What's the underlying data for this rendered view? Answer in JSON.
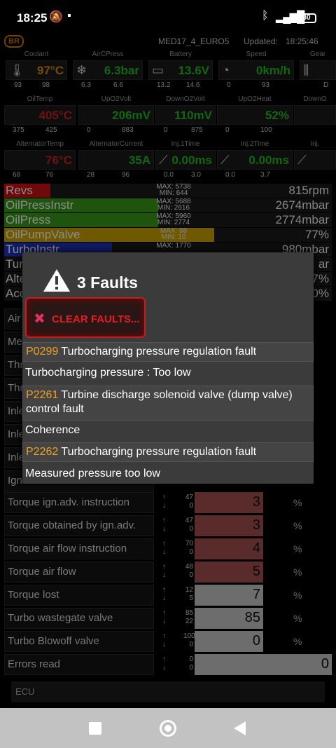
{
  "status": {
    "time": "18:25",
    "battery": "30"
  },
  "header": {
    "badge": "BR",
    "ecu": "MED17_4_EURO5",
    "updated_label": "Updated:",
    "updated_time": "18:25:46"
  },
  "gauges_row1": [
    {
      "label": "Coolant",
      "icon": "thermometer-icon",
      "glyph": "🌡",
      "value": "97°C",
      "color": "#d88a00",
      "min": "93",
      "max": "98"
    },
    {
      "label": "AirCPress",
      "icon": "snowflake-icon",
      "glyph": "❄",
      "value": "6.3bar",
      "color": "#22bb22",
      "min": "6.3",
      "max": "6.6"
    },
    {
      "label": "Battery",
      "icon": "battery-icon",
      "glyph": "▭",
      "value": "13.6V",
      "color": "#22bb22",
      "min": "13.2",
      "max": "14.6"
    },
    {
      "label": "Speed",
      "icon": "speedometer-icon",
      "glyph": "◔",
      "value": "0km/h",
      "color": "#22bb22",
      "min": "0",
      "max": "93"
    },
    {
      "label": "Gear",
      "icon": "gear-shift-icon",
      "glyph": "⫼",
      "value": "",
      "color": "#22bb22",
      "min": "",
      "max": "D"
    }
  ],
  "gauges_row2": [
    {
      "label": "OilTemp",
      "value": "405°C",
      "color": "#cc2222",
      "min": "375",
      "max": "425"
    },
    {
      "label": "UpO2Volt",
      "value": "206mV",
      "color": "#22bb22",
      "min": "0",
      "max": "883"
    },
    {
      "label": "DownO2Volt",
      "value": "110mV",
      "color": "#22bb22",
      "min": "0",
      "max": "875"
    },
    {
      "label": "UpO2Heat",
      "value": "52%",
      "color": "#22bb22",
      "min": "0",
      "max": "100"
    },
    {
      "label": "DownO",
      "value": "",
      "color": "#22bb22",
      "min": "",
      "max": ""
    }
  ],
  "gauges_row3": [
    {
      "label": "AlternatorTemp",
      "value": "76°C",
      "color": "#cc2222",
      "min": "68",
      "max": "76"
    },
    {
      "label": "AlternatorCurrent",
      "value": "35A",
      "color": "#22bb22",
      "min": "28",
      "max": "96"
    },
    {
      "label": "Inj.1Time",
      "icon": "injector-icon",
      "glyph": "⟋",
      "value": "0.00ms",
      "color": "#22bb22",
      "min": "0.0",
      "max": "3.0"
    },
    {
      "label": "Inj.2Time",
      "icon": "injector-icon",
      "glyph": "⟋",
      "value": "0.00ms",
      "color": "#22bb22",
      "min": "0.0",
      "max": "3.7"
    },
    {
      "label": "Inj.",
      "icon": "injector-icon",
      "glyph": "⟋",
      "value": "",
      "color": "#22bb22",
      "min": "",
      "max": ""
    }
  ],
  "bars": [
    {
      "name": "Revs",
      "max": "MAX: 5738",
      "min": "MIN: 644",
      "value": "815rpm",
      "fill": 0.14,
      "color": "#cc1111"
    },
    {
      "name": "OilPressInstr",
      "max": "MAX: 5688",
      "min": "MIN: 2616",
      "value": "2674mbar",
      "fill": 0.47,
      "color": "#3a9a1a"
    },
    {
      "name": "OilPress",
      "max": "MAX: 5960",
      "min": "MIN: 2774",
      "value": "2774mbar",
      "fill": 0.47,
      "color": "#3a9a1a"
    },
    {
      "name": "OilPumpValve",
      "max": "MAX: 88",
      "min": "MIN: 10",
      "value": "77%",
      "fill": 0.64,
      "color": "#c8a000"
    },
    {
      "name": "TurboInstr",
      "max": "MAX: 1770",
      "min": "",
      "value": "980mbar",
      "fill": 0.33,
      "color": "#2233bb"
    },
    {
      "name": "Tur",
      "max": "",
      "min": "",
      "value": "ar",
      "fill": 0.0,
      "color": "#3a9a1a"
    },
    {
      "name": "Alte",
      "max": "",
      "min": "",
      "value": "7%",
      "fill": 0.0,
      "color": "#3a9a1a"
    },
    {
      "name": "Acc",
      "max": "",
      "min": "",
      "value": "0%",
      "fill": 0.0,
      "color": "#3a9a1a"
    }
  ],
  "hidden_rows": [
    "Air",
    "Me",
    "Thr",
    "Thr",
    "Inle",
    "Inle",
    "Inle",
    "Ign"
  ],
  "table": [
    {
      "name": "Torque ign.adv. instruction",
      "max": "47",
      "min": "0",
      "value": "3",
      "unit": "%",
      "red": true
    },
    {
      "name": "Torque obtained by ign.adv.",
      "max": "47",
      "min": "0",
      "value": "3",
      "unit": "%",
      "red": true
    },
    {
      "name": "Torque air flow instruction",
      "max": "70",
      "min": "0",
      "value": "4",
      "unit": "%",
      "red": true
    },
    {
      "name": "Torque air flow",
      "max": "48",
      "min": "0",
      "value": "5",
      "unit": "%",
      "red": true
    },
    {
      "name": "Torque lost",
      "max": "12",
      "min": "5",
      "value": "7",
      "unit": "%",
      "red": false
    },
    {
      "name": "Turbo wastegate valve",
      "max": "85",
      "min": "22",
      "value": "85",
      "unit": "%",
      "red": false
    },
    {
      "name": "Turbo Blowoff valve",
      "max": "100",
      "min": "0",
      "value": "0",
      "unit": "%",
      "red": false
    },
    {
      "name": "Errors read",
      "max": "0",
      "min": "0",
      "value": "0",
      "unit": "",
      "red": false
    }
  ],
  "ecu_label": "ECU",
  "dialog": {
    "title": "3 Faults",
    "clear_label": "CLEAR FAULTS...",
    "faults": [
      {
        "code": "P0299",
        "text": "Turbocharging pressure regulation fault",
        "detail": "Turbocharging pressure : Too low"
      },
      {
        "code": "P2261",
        "text": "Turbine discharge solenoid valve (dump valve) control fault",
        "detail": "Coherence"
      },
      {
        "code": "P2262",
        "text": "Turbocharging pressure regulation fault",
        "detail": "Measured pressure too low"
      }
    ]
  }
}
